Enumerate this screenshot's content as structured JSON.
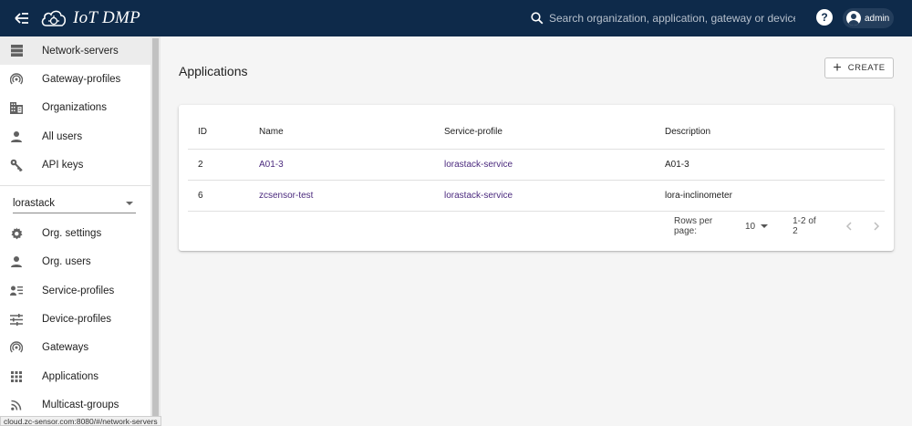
{
  "app": {
    "title": "IoT DMP"
  },
  "search": {
    "placeholder": "Search organization, application, gateway or device"
  },
  "header": {
    "help": "?",
    "user": "admin"
  },
  "sidebar": {
    "global_items": [
      {
        "label": "Network-servers",
        "icon": "server-icon",
        "active": true
      },
      {
        "label": "Gateway-profiles",
        "icon": "broadcast-icon"
      },
      {
        "label": "Organizations",
        "icon": "building-icon"
      },
      {
        "label": "All users",
        "icon": "person-icon"
      },
      {
        "label": "API keys",
        "icon": "key-icon"
      }
    ],
    "org_select": "lorastack",
    "org_items": [
      {
        "label": "Org. settings",
        "icon": "gear-icon"
      },
      {
        "label": "Org. users",
        "icon": "person-icon"
      },
      {
        "label": "Service-profiles",
        "icon": "account-details-icon"
      },
      {
        "label": "Device-profiles",
        "icon": "tune-icon"
      },
      {
        "label": "Gateways",
        "icon": "broadcast-icon"
      },
      {
        "label": "Applications",
        "icon": "apps-grid-icon"
      },
      {
        "label": "Multicast-groups",
        "icon": "rss-icon"
      }
    ]
  },
  "page": {
    "title": "Applications",
    "create_label": "CREATE"
  },
  "table": {
    "columns": [
      "ID",
      "Name",
      "Service-profile",
      "Description"
    ],
    "rows": [
      {
        "id": "2",
        "name": "A01-3",
        "service_profile": "lorastack-service",
        "description": "A01-3"
      },
      {
        "id": "6",
        "name": "zcsensor-test",
        "service_profile": "lorastack-service",
        "description": "lora-inclinometer"
      }
    ]
  },
  "pagination": {
    "rows_per_page_label": "Rows per page:",
    "rows_per_page": "10",
    "range": "1-2 of 2"
  },
  "statusbar": {
    "url": "cloud.zc-sensor.com:8080/#/network-servers"
  },
  "colors": {
    "topbar": "#0e2a4a",
    "link": "#4b2a7e",
    "active_nav": "#ececec"
  }
}
